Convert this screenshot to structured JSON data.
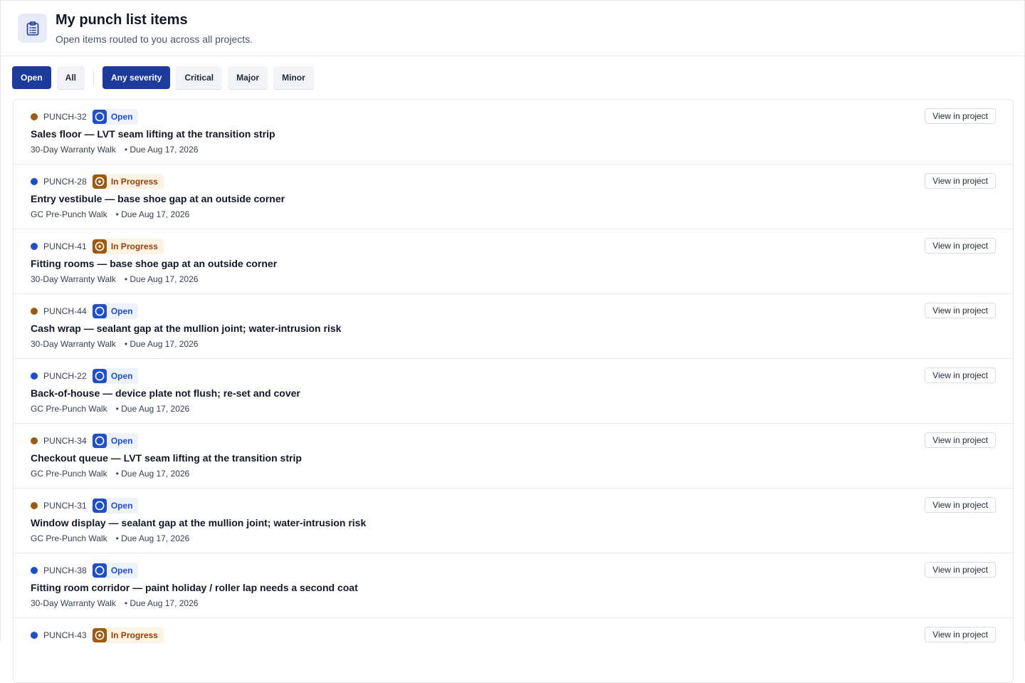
{
  "header": {
    "title": "My punch list items",
    "subtitle": "Open items routed to you across all projects.",
    "icon": "clipboard-icon"
  },
  "filters": {
    "status": [
      {
        "label": "Open",
        "active": true
      },
      {
        "label": "All",
        "active": false
      }
    ],
    "severity": [
      {
        "label": "Any severity",
        "active": true
      },
      {
        "label": "Critical",
        "active": false
      },
      {
        "label": "Major",
        "active": false
      },
      {
        "label": "Minor",
        "active": false
      }
    ]
  },
  "colors": {
    "accent": "#1d3a9d",
    "severity_major": "#9a5a12",
    "severity_minor": "#1e4fc4"
  },
  "view_label": "View in project",
  "items": [
    {
      "id": "PUNCH-32",
      "severity": "major",
      "status": "Open",
      "status_kind": "open",
      "title": "Sales floor — LVT seam lifting at the transition strip",
      "walk": "30-Day Warranty Walk",
      "due": "• Due Aug 17, 2026"
    },
    {
      "id": "PUNCH-28",
      "severity": "minor",
      "status": "In Progress",
      "status_kind": "progress",
      "title": "Entry vestibule — base shoe gap at an outside corner",
      "walk": "GC Pre-Punch Walk",
      "due": "• Due Aug 17, 2026"
    },
    {
      "id": "PUNCH-41",
      "severity": "minor",
      "status": "In Progress",
      "status_kind": "progress",
      "title": "Fitting rooms — base shoe gap at an outside corner",
      "walk": "30-Day Warranty Walk",
      "due": "• Due Aug 17, 2026"
    },
    {
      "id": "PUNCH-44",
      "severity": "major",
      "status": "Open",
      "status_kind": "open",
      "title": "Cash wrap — sealant gap at the mullion joint; water-intrusion risk",
      "walk": "30-Day Warranty Walk",
      "due": "• Due Aug 17, 2026"
    },
    {
      "id": "PUNCH-22",
      "severity": "minor",
      "status": "Open",
      "status_kind": "open",
      "title": "Back-of-house — device plate not flush; re-set and cover",
      "walk": "GC Pre-Punch Walk",
      "due": "• Due Aug 17, 2026"
    },
    {
      "id": "PUNCH-34",
      "severity": "major",
      "status": "Open",
      "status_kind": "open",
      "title": "Checkout queue — LVT seam lifting at the transition strip",
      "walk": "GC Pre-Punch Walk",
      "due": "• Due Aug 17, 2026"
    },
    {
      "id": "PUNCH-31",
      "severity": "major",
      "status": "Open",
      "status_kind": "open",
      "title": "Window display — sealant gap at the mullion joint; water-intrusion risk",
      "walk": "GC Pre-Punch Walk",
      "due": "• Due Aug 17, 2026"
    },
    {
      "id": "PUNCH-38",
      "severity": "minor",
      "status": "Open",
      "status_kind": "open",
      "title": "Fitting room corridor — paint holiday / roller lap needs a second coat",
      "walk": "30-Day Warranty Walk",
      "due": "• Due Aug 17, 2026"
    },
    {
      "id": "PUNCH-43",
      "severity": "minor",
      "status": "In Progress",
      "status_kind": "progress",
      "title": "",
      "walk": "",
      "due": ""
    }
  ]
}
